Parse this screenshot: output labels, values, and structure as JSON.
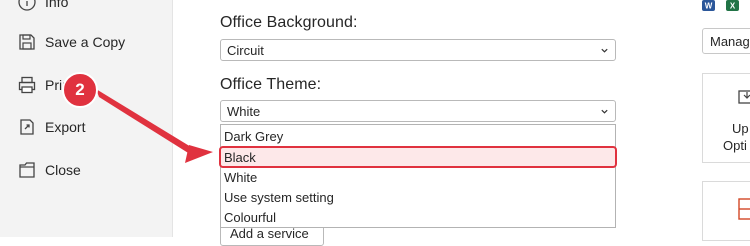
{
  "sidebar": {
    "items": [
      {
        "label": "Info",
        "icon": "info-icon"
      },
      {
        "label": "Save a Copy",
        "icon": "save-copy-icon"
      },
      {
        "label": "Print",
        "icon": "printer-icon"
      },
      {
        "label": "Export",
        "icon": "export-icon"
      },
      {
        "label": "Close",
        "icon": "close-document-icon"
      }
    ]
  },
  "main": {
    "background": {
      "label": "Office Background:",
      "value": "Circuit"
    },
    "theme": {
      "label": "Office Theme:",
      "value": "White",
      "options": [
        "Dark Grey",
        "Black",
        "White",
        "Use system setting",
        "Colourful"
      ],
      "highlighted": "Black"
    },
    "add_service_label": "Add a service"
  },
  "right": {
    "manage_label": "Manag",
    "tile_top_line1": "Up",
    "tile_top_line2": "Opti"
  },
  "annotation": {
    "step_number": "2",
    "color": "#e0323f"
  },
  "colors": {
    "word": "#2b579a",
    "excel": "#217346",
    "highlight": "#e0323f",
    "sidebar_bg": "#f3f3f3"
  }
}
